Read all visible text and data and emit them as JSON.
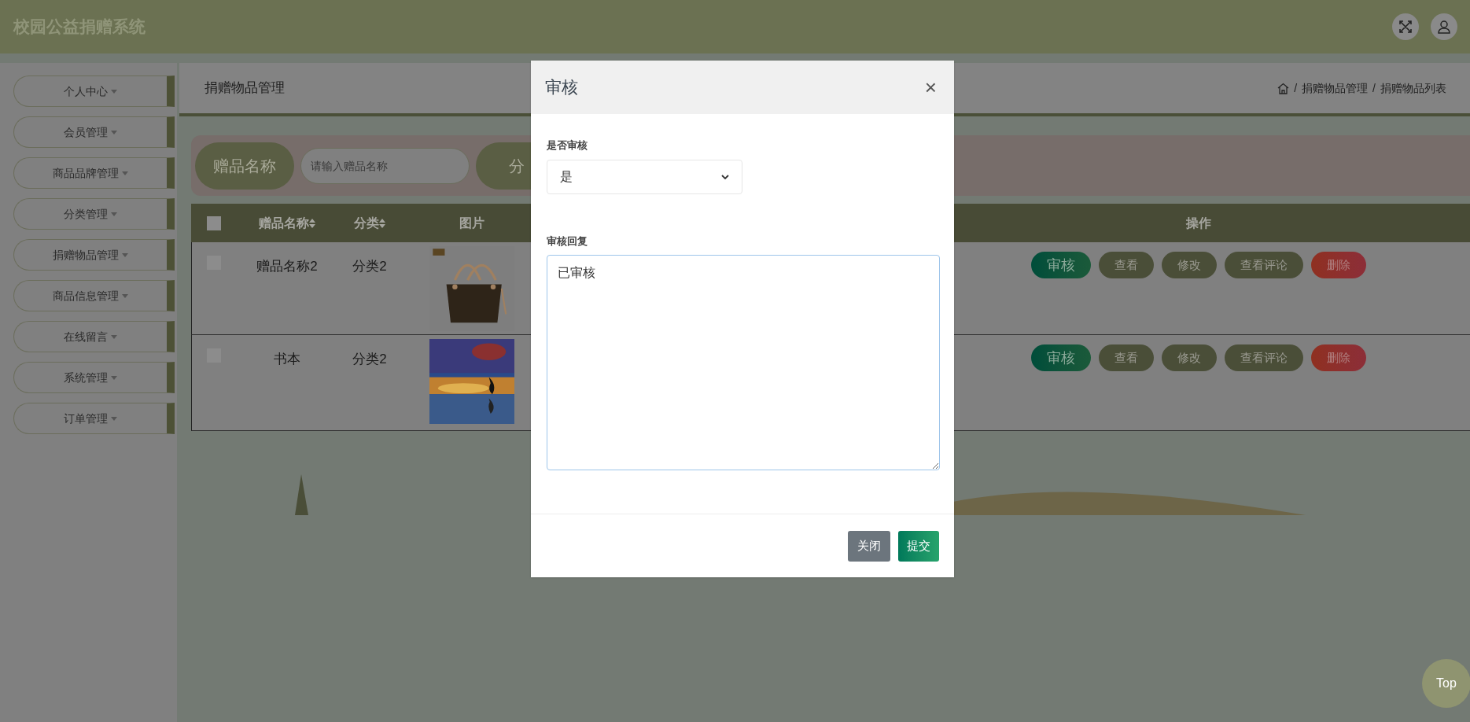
{
  "header": {
    "title": "校园公益捐赠系统"
  },
  "sidebar": {
    "items": [
      {
        "label": "个人中心"
      },
      {
        "label": "会员管理"
      },
      {
        "label": "商品品牌管理"
      },
      {
        "label": "分类管理"
      },
      {
        "label": "捐赠物品管理"
      },
      {
        "label": "商品信息管理"
      },
      {
        "label": "在线留言"
      },
      {
        "label": "系统管理"
      },
      {
        "label": "订单管理"
      }
    ]
  },
  "page_title": "捐赠物品管理",
  "breadcrumb": [
    {
      "separator": "/",
      "label": "捐赠物品管理"
    },
    {
      "separator": "/",
      "label": "捐赠物品列表"
    }
  ],
  "search": {
    "label": "赠品名称",
    "placeholder": "请输入赠品名称",
    "next_label": "分"
  },
  "table": {
    "select_all_checked": false,
    "columns": [
      {
        "label": "赠品名称",
        "sortable": true
      },
      {
        "label": "分类",
        "sortable": true
      },
      {
        "label": "图片",
        "sortable": false
      },
      {
        "label": "操作",
        "sortable": false
      }
    ],
    "rows": [
      {
        "checked": false,
        "name": "赠品名称2",
        "category": "分类2",
        "actions": [
          {
            "label": "审核",
            "kind": "primary"
          },
          {
            "label": "查看",
            "kind": "default"
          },
          {
            "label": "修改",
            "kind": "default"
          },
          {
            "label": "查看评论",
            "kind": "default"
          },
          {
            "label": "删除",
            "kind": "danger"
          }
        ]
      },
      {
        "checked": false,
        "name": "书本",
        "category": "分类2",
        "actions": [
          {
            "label": "审核",
            "kind": "primary"
          },
          {
            "label": "查看",
            "kind": "default"
          },
          {
            "label": "修改",
            "kind": "default"
          },
          {
            "label": "查看评论",
            "kind": "default"
          },
          {
            "label": "删除",
            "kind": "danger"
          }
        ]
      }
    ]
  },
  "modal": {
    "title": "审核",
    "close": "×",
    "audit_label": "是否审核",
    "audit_value": "是",
    "reply_label": "审核回复",
    "reply_value": "已审核",
    "buttons": [
      {
        "label": "关闭",
        "kind": "secondary"
      },
      {
        "label": "提交",
        "kind": "primary"
      }
    ]
  },
  "top_button": "Top"
}
